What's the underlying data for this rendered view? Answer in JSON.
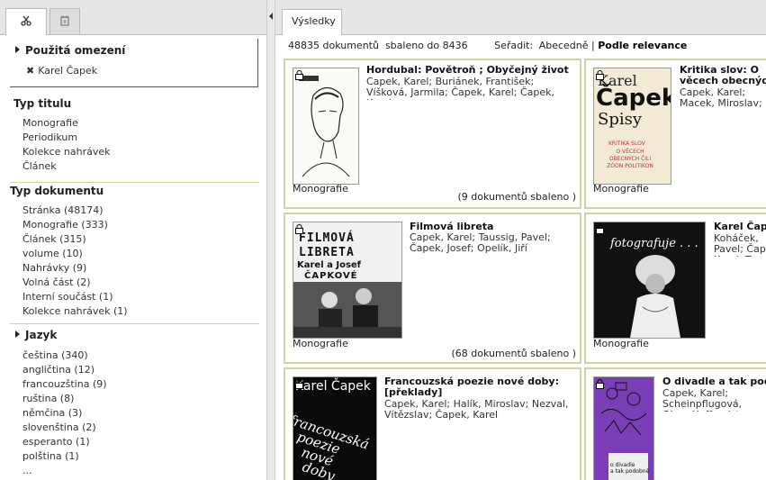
{
  "left": {
    "applied_title": "Použitá omezení",
    "applied_item": "Karel Čapek",
    "typ_titulu": {
      "title": "Typ titulu",
      "items": [
        "Monografie",
        "Periodikum",
        "Kolekce nahrávek",
        "Článek"
      ]
    },
    "typ_dokumentu": {
      "title": "Typ dokumentu",
      "items": [
        "Stránka (48174)",
        "Monografie (333)",
        "Článek (315)",
        "volume (10)",
        "Nahrávky (9)",
        "Volná část (2)",
        "Interní součást (1)",
        "Kolekce nahrávek (1)"
      ]
    },
    "jazyk": {
      "title": "Jazyk",
      "items": [
        "čeština (340)",
        "angličtina (12)",
        "francouzština (9)",
        "ruština (8)",
        "němčina (3)",
        "slovenština (2)",
        "esperanto (1)",
        "polština (1)",
        "..."
      ]
    }
  },
  "right": {
    "tab": "Výsledky",
    "count_text": "48835 dokumentů  sbaleno do 8436",
    "sort_label": "Seřadit:",
    "sort_alpha": "Abecedně",
    "sort_sep": "|",
    "sort_rel": "Podle relevance"
  },
  "cards": [
    {
      "title": "Hordubal: Povětroň ; Obyčejný život",
      "authors": "Čapek, Karel; Buriánek, František; Víšková, Jarmila; Čapek, Karel; Čapek, Karel",
      "type": "Monografie",
      "count": "(9 dokumentů sbaleno )",
      "cover": "portrait"
    },
    {
      "title": "Kritika slov: O věcech obecných čili zóon politikon",
      "authors": "Čapek, Karel; Macek, Miroslav; Pohorský, Miloš; Klímová, Marina; Pohorský, Miloš",
      "type": "Monografie",
      "count": "",
      "cover": "spisy",
      "cover_texts": [
        "Karel",
        "Čapek",
        "Spisy",
        "KRITIKA SLOV",
        "O VĚCECH OBECNÝCH ČILI ZÓON POLITIKON"
      ]
    },
    {
      "title": "Filmová libreta",
      "authors": "Čapek, Karel; Taussig, Pavel; Čapek, Josef; Opelík, Jiří",
      "type": "Monografie",
      "count": "(68 dokumentů sbaleno )",
      "cover": "libreta",
      "cover_texts": [
        "FILMOVÁ",
        "LIBRETA",
        "Karel a Josef",
        "ČAPKOVÉ"
      ]
    },
    {
      "title": "Karel Čapek fotografuje",
      "authors": "Koháček, Pavel; Čapek, Karel; Taussig, Pavel; Scheufler, Pavel; Scheufler, Pavel",
      "type": "Monografie",
      "count": "",
      "cover": "foto",
      "cover_texts": [
        "fotografuje . . ."
      ]
    },
    {
      "title": "Francouzská poezie nové doby: [překlady]",
      "authors": "Čapek, Karel; Halík, Miroslav; Nezval, Vítězslav; Čapek, Karel",
      "type": "",
      "count": "",
      "cover": "poezie",
      "cover_texts": [
        "Karel Čapek",
        "francouzská",
        "poezie",
        "nové",
        "doby"
      ]
    },
    {
      "title": "O divadle a tak podobně",
      "authors": "Čapek, Karel; Scheinpflugová, Olga; Hoffmeister, Adolf; Čapek, Josef",
      "type": "",
      "count": "",
      "cover": "divadle",
      "cover_texts": [
        "o divadle",
        "a tak podobně"
      ]
    }
  ],
  "colors": {
    "card_border": "#c8d8a0",
    "tab_bar": "#e6e6e6",
    "divadle_purple": "#7a3fb6"
  }
}
